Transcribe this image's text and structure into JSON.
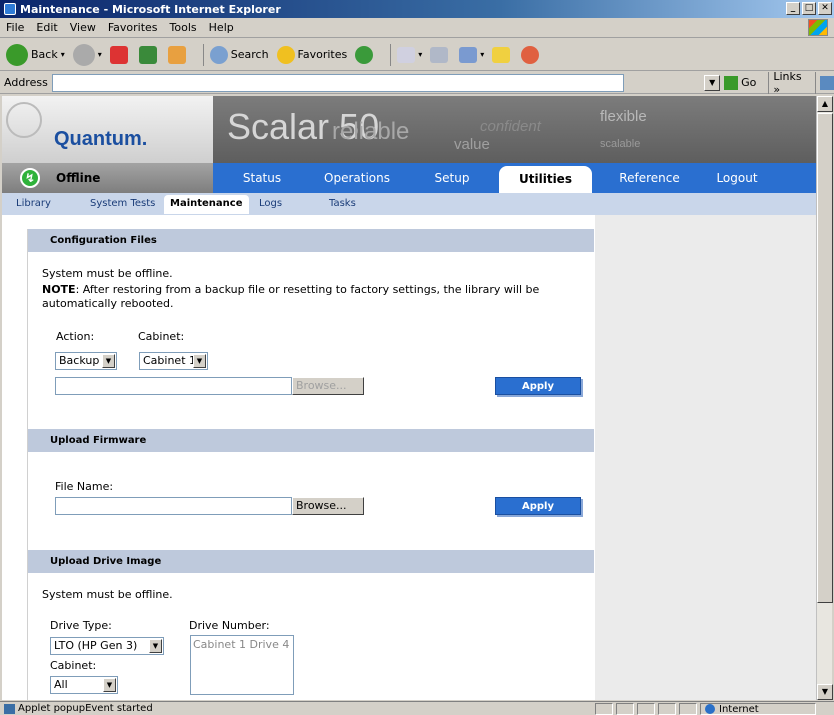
{
  "window": {
    "title": "Maintenance - Microsoft Internet Explorer",
    "minimize": "_",
    "maximize": "□",
    "close": "✕"
  },
  "menu": [
    "File",
    "Edit",
    "View",
    "Favorites",
    "Tools",
    "Help"
  ],
  "toolbar": {
    "back": "Back",
    "search": "Search",
    "favorites": "Favorites"
  },
  "address": {
    "label": "Address",
    "value": "",
    "go": "Go",
    "links": "Links »"
  },
  "header": {
    "logo": "Quantum.",
    "product": "Scalar 50",
    "bg_words": [
      "reliable",
      "confident",
      "value",
      "flexible",
      "scalable"
    ]
  },
  "status": {
    "state": "Offline",
    "color": "#2fb23a"
  },
  "nav": {
    "tabs": [
      "Status",
      "Operations",
      "Setup",
      "Utilities",
      "Reference",
      "Logout"
    ],
    "active": "Utilities"
  },
  "subnav": {
    "items": [
      "Library",
      "System Tests",
      "Maintenance",
      "Logs",
      "Tasks"
    ],
    "active": "Maintenance"
  },
  "sections": {
    "config": {
      "title": "Configuration Files",
      "line1": "System must be offline.",
      "note_label": "NOTE",
      "note_text": ": After restoring from a backup file or resetting to factory settings, the library will be",
      "note_text2": "automatically rebooted.",
      "action_label": "Action:",
      "cabinet_label": "Cabinet:",
      "action_value": "Backup",
      "cabinet_value": "Cabinet 1",
      "file_value": "",
      "browse": "Browse...",
      "apply": "Apply"
    },
    "firmware": {
      "title": "Upload Firmware",
      "file_label": "File Name:",
      "file_value": "",
      "browse": "Browse...",
      "apply": "Apply"
    },
    "drive": {
      "title": "Upload Drive Image",
      "line1": "System must be offline.",
      "drive_type_label": "Drive Type:",
      "drive_type_value": "LTO (HP Gen 3)",
      "drive_number_label": "Drive Number:",
      "drive_number_options": [
        "Cabinet 1 Drive 4"
      ],
      "cabinet_label": "Cabinet:",
      "cabinet_value": "All"
    }
  },
  "statusbar": {
    "text": "Applet popupEvent started",
    "zone": "Internet"
  }
}
